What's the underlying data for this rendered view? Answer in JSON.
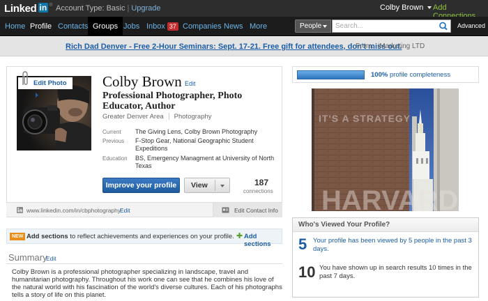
{
  "topbar": {
    "logo_word": "Linked",
    "logo_in": "in",
    "logo_reg": "®",
    "account_type": "Account Type: Basic",
    "separator": "|",
    "upgrade": "Upgrade",
    "user_name": "Colby Brown",
    "add_connections": "Add Connections"
  },
  "nav": {
    "items": [
      {
        "label": "Home"
      },
      {
        "label": "Profile"
      },
      {
        "label": "Contacts"
      },
      {
        "label": "Groups"
      },
      {
        "label": "Jobs"
      },
      {
        "label": "Inbox"
      },
      {
        "label": "Companies"
      },
      {
        "label": "News"
      },
      {
        "label": "More"
      }
    ],
    "inbox_count": "37",
    "search_scope": "People",
    "search_placeholder": "Search...",
    "advanced": "Advanced"
  },
  "adbar": {
    "link": "Rich Dad Denver - Free 2-Hour Seminars: Sept. 17-21. Free gift for attendees, don't miss out.",
    "from_label": "From:",
    "from_source": "iMarketing LTD"
  },
  "profile": {
    "edit_photo": "Edit Photo",
    "name": "Colby Brown",
    "name_edit": "Edit",
    "headline": "Professional Photographer, Photo Educator, Author",
    "location": "Greater Denver Area",
    "industry": "Photography",
    "current_label": "Current",
    "current_value": "The Giving Lens, Colby Brown Photography",
    "previous_label": "Previous",
    "previous_value": "F-Stop Gear, National Geographic Student Expeditions",
    "education_label": "Education",
    "education_value": "BS, Emergency Managment at University of North Texas",
    "improve_button": "Improve your profile",
    "view_button": "View",
    "connections_count": "187",
    "connections_label": "connections",
    "public_url": "www.linkedin.com/in/cbphotography",
    "url_edit": "Edit",
    "edit_contact": "Edit Contact Info"
  },
  "add_sections": {
    "badge": "NEW",
    "bold": "Add sections",
    "text": " to reflect achievements and experiences on your profile.",
    "link": "Add sections"
  },
  "summary": {
    "title": "Summary",
    "edit": "Edit",
    "text": "Colby Brown is a professional photographer specializing in landscape, travel and humanitarian photography. Throughout his work one can see that he combines his love of the natural world with his fascination of the world's diverse cultures. Each of his photographs tells a story of life on this planet."
  },
  "completeness": {
    "percent": "100%",
    "label": " profile completeness",
    "fraction": 1.0
  },
  "ad_image": {
    "slogan": "IT'S A STRATEGY",
    "word": "HARVARD"
  },
  "who_viewed": {
    "title": "Who's Viewed Your Profile?",
    "views_count": "5",
    "views_text": "Your profile has been viewed by 5 people in the past 3 days.",
    "search_count": "10",
    "search_text": "You have shown up in search results 10 times in the past 7 days."
  },
  "colors": {
    "link_blue": "#1b5da6",
    "nav_blue": "#6cb5e8",
    "green": "#8fc23f",
    "badge_red": "#c32d2d"
  }
}
